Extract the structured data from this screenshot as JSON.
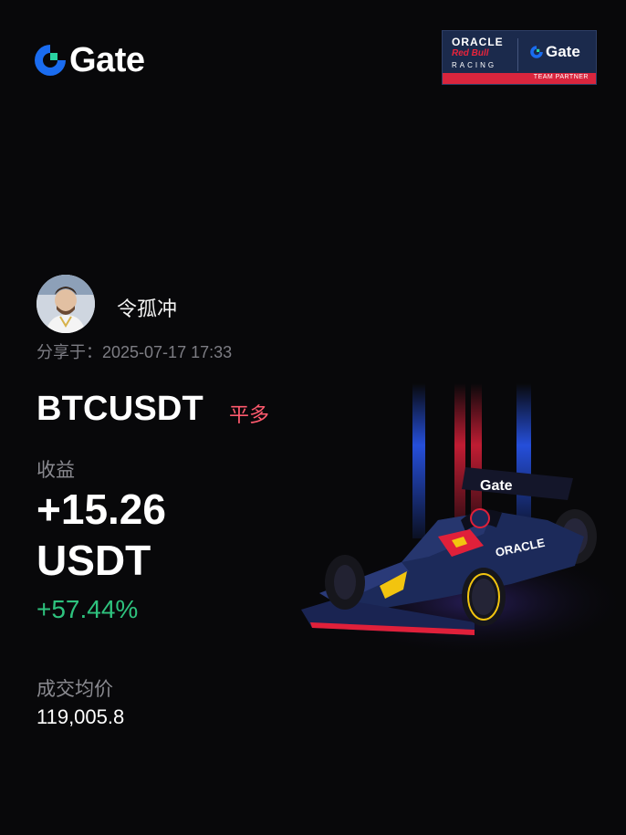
{
  "brand": {
    "name": "Gate",
    "mark_color": "#1a6cf0",
    "icon": "gate-logo-icon"
  },
  "partner": {
    "line1": "ORACLE",
    "line2": "Red Bull",
    "line3": "RACING",
    "partner_brand": "Gate",
    "footer": "TEAM PARTNER",
    "bg_color": "#1b2a4c",
    "accent_color": "#d9253d"
  },
  "user": {
    "name": "令孤冲",
    "avatar_icon": "user-avatar-icon",
    "share_label": "分享于：",
    "share_time": "2025-07-17 17:33"
  },
  "trade": {
    "pair": "BTCUSDT",
    "side": "平多",
    "side_color": "#ff5a6e",
    "pnl_label": "收益",
    "pnl_value": "+15.26",
    "pnl_unit": "USDT",
    "pnl_percent": "+57.44%",
    "pnl_percent_color": "#2ec27e",
    "avg_price_label": "成交均价",
    "avg_price": "119,005.8"
  },
  "scene": {
    "icon": "race-car-icon",
    "car_body_text": "Gate",
    "car_side_text": "ORACLE"
  }
}
